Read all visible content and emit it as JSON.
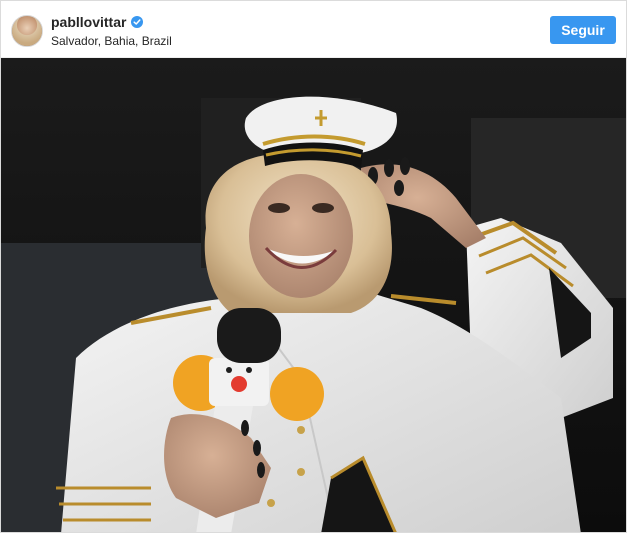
{
  "post": {
    "username": "pabllovittar",
    "location": "Salvador, Bahia, Brazil",
    "follow_label": "Seguir",
    "verified_icon": "verified-badge-icon",
    "accent_color": "#3897f0"
  }
}
